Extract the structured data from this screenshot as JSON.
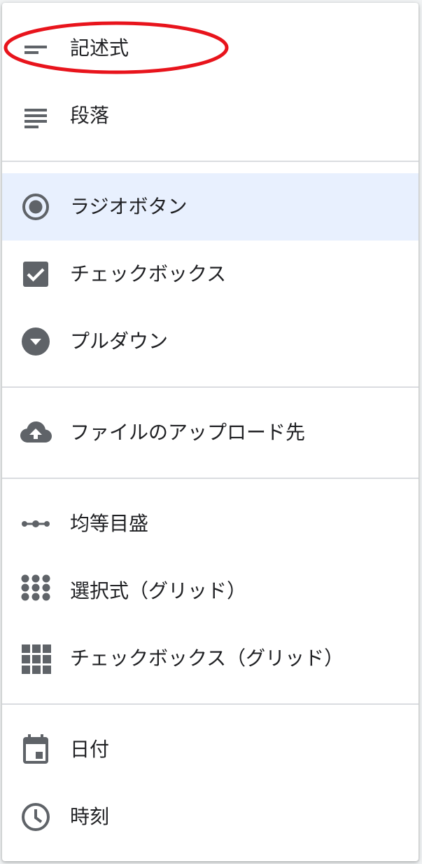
{
  "colors": {
    "icon": "#5f6368",
    "text": "#202124",
    "selected_bg": "#e8f0fe",
    "divider": "#dadce0",
    "annotation": "#e8141c"
  },
  "menu": {
    "items": [
      {
        "label": "記述式",
        "icon": "short-answer-icon"
      },
      {
        "label": "段落",
        "icon": "paragraph-icon"
      },
      {
        "label": "ラジオボタン",
        "icon": "radio-button-icon",
        "selected": true
      },
      {
        "label": "チェックボックス",
        "icon": "checkbox-icon"
      },
      {
        "label": "プルダウン",
        "icon": "dropdown-icon"
      },
      {
        "label": "ファイルのアップロード先",
        "icon": "cloud-upload-icon"
      },
      {
        "label": "均等目盛",
        "icon": "linear-scale-icon"
      },
      {
        "label": "選択式（グリッド）",
        "icon": "multiple-choice-grid-icon"
      },
      {
        "label": "チェックボックス（グリッド）",
        "icon": "checkbox-grid-icon"
      },
      {
        "label": "日付",
        "icon": "calendar-icon"
      },
      {
        "label": "時刻",
        "icon": "clock-icon"
      }
    ]
  }
}
